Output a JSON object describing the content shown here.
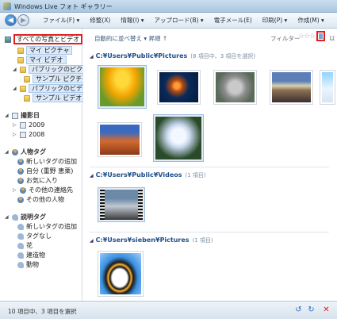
{
  "window": {
    "title": "Windows Live フォト ギャラリー"
  },
  "menu": [
    "ファイル(F) ▾",
    "修整(X)",
    "情報(I) ▾",
    "アップロード(B) ▾",
    "電子メール(E)",
    "印刷(P) ▾",
    "作成(M) ▾"
  ],
  "sortbar": {
    "sort": "自動的に並べ替え ▾   昇順 ↑",
    "filter": "フィルター",
    "stars": "☆☆☆",
    "cut": "以"
  },
  "tree": {
    "all": "すべての写真とビデオ",
    "my_pictures": "マイ ピクチャ",
    "my_videos": "マイ ビデオ",
    "public_pictures": "パブリックのピクチャ",
    "sample_pictures": "サンプル ピクチャ",
    "public_videos": "パブリックのビデオ",
    "sample_videos": "サンプル ビデオ",
    "date_taken": "撮影日",
    "y2009": "2009",
    "y2008": "2008",
    "people_tags": "人物タグ",
    "add_new_tag_people": "新しいタグの追加",
    "me": "自分 (重野 恵栗)",
    "favorites": "お気に入り",
    "other_contacts": "その他の連絡先",
    "other_people": "その他の人物",
    "desc_tags": "説明タグ",
    "add_new_tag_desc": "新しいタグの追加",
    "untagged": "タグなし",
    "flowers": "花",
    "buildings": "建造物",
    "animals": "動物"
  },
  "sections": [
    {
      "path": "C:¥Users¥Public¥Pictures",
      "count": "(8 項目中、3 項目を選択)"
    },
    {
      "path": "C:¥Users¥Public¥Videos",
      "count": "(1 項目)"
    },
    {
      "path": "C:¥Users¥sieben¥Pictures",
      "count": "(1 項目)"
    }
  ],
  "status": {
    "text": "10 項目中、3 項目を選択"
  },
  "colors": {
    "highlight": "#e02020",
    "accent": "#1f4f8a"
  }
}
